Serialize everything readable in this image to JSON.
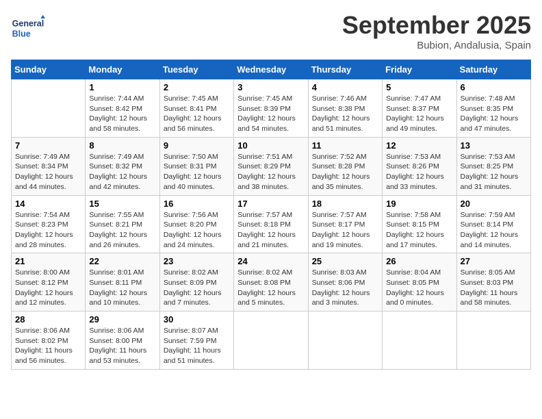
{
  "logo": {
    "text_general": "General",
    "text_blue": "Blue"
  },
  "title": "September 2025",
  "subtitle": "Bubion, Andalusia, Spain",
  "days_header": [
    "Sunday",
    "Monday",
    "Tuesday",
    "Wednesday",
    "Thursday",
    "Friday",
    "Saturday"
  ],
  "weeks": [
    [
      {
        "num": "",
        "info": ""
      },
      {
        "num": "1",
        "info": "Sunrise: 7:44 AM\nSunset: 8:42 PM\nDaylight: 12 hours and 58 minutes."
      },
      {
        "num": "2",
        "info": "Sunrise: 7:45 AM\nSunset: 8:41 PM\nDaylight: 12 hours and 56 minutes."
      },
      {
        "num": "3",
        "info": "Sunrise: 7:45 AM\nSunset: 8:39 PM\nDaylight: 12 hours and 54 minutes."
      },
      {
        "num": "4",
        "info": "Sunrise: 7:46 AM\nSunset: 8:38 PM\nDaylight: 12 hours and 51 minutes."
      },
      {
        "num": "5",
        "info": "Sunrise: 7:47 AM\nSunset: 8:37 PM\nDaylight: 12 hours and 49 minutes."
      },
      {
        "num": "6",
        "info": "Sunrise: 7:48 AM\nSunset: 8:35 PM\nDaylight: 12 hours and 47 minutes."
      }
    ],
    [
      {
        "num": "7",
        "info": "Sunrise: 7:49 AM\nSunset: 8:34 PM\nDaylight: 12 hours and 44 minutes."
      },
      {
        "num": "8",
        "info": "Sunrise: 7:49 AM\nSunset: 8:32 PM\nDaylight: 12 hours and 42 minutes."
      },
      {
        "num": "9",
        "info": "Sunrise: 7:50 AM\nSunset: 8:31 PM\nDaylight: 12 hours and 40 minutes."
      },
      {
        "num": "10",
        "info": "Sunrise: 7:51 AM\nSunset: 8:29 PM\nDaylight: 12 hours and 38 minutes."
      },
      {
        "num": "11",
        "info": "Sunrise: 7:52 AM\nSunset: 8:28 PM\nDaylight: 12 hours and 35 minutes."
      },
      {
        "num": "12",
        "info": "Sunrise: 7:53 AM\nSunset: 8:26 PM\nDaylight: 12 hours and 33 minutes."
      },
      {
        "num": "13",
        "info": "Sunrise: 7:53 AM\nSunset: 8:25 PM\nDaylight: 12 hours and 31 minutes."
      }
    ],
    [
      {
        "num": "14",
        "info": "Sunrise: 7:54 AM\nSunset: 8:23 PM\nDaylight: 12 hours and 28 minutes."
      },
      {
        "num": "15",
        "info": "Sunrise: 7:55 AM\nSunset: 8:21 PM\nDaylight: 12 hours and 26 minutes."
      },
      {
        "num": "16",
        "info": "Sunrise: 7:56 AM\nSunset: 8:20 PM\nDaylight: 12 hours and 24 minutes."
      },
      {
        "num": "17",
        "info": "Sunrise: 7:57 AM\nSunset: 8:18 PM\nDaylight: 12 hours and 21 minutes."
      },
      {
        "num": "18",
        "info": "Sunrise: 7:57 AM\nSunset: 8:17 PM\nDaylight: 12 hours and 19 minutes."
      },
      {
        "num": "19",
        "info": "Sunrise: 7:58 AM\nSunset: 8:15 PM\nDaylight: 12 hours and 17 minutes."
      },
      {
        "num": "20",
        "info": "Sunrise: 7:59 AM\nSunset: 8:14 PM\nDaylight: 12 hours and 14 minutes."
      }
    ],
    [
      {
        "num": "21",
        "info": "Sunrise: 8:00 AM\nSunset: 8:12 PM\nDaylight: 12 hours and 12 minutes."
      },
      {
        "num": "22",
        "info": "Sunrise: 8:01 AM\nSunset: 8:11 PM\nDaylight: 12 hours and 10 minutes."
      },
      {
        "num": "23",
        "info": "Sunrise: 8:02 AM\nSunset: 8:09 PM\nDaylight: 12 hours and 7 minutes."
      },
      {
        "num": "24",
        "info": "Sunrise: 8:02 AM\nSunset: 8:08 PM\nDaylight: 12 hours and 5 minutes."
      },
      {
        "num": "25",
        "info": "Sunrise: 8:03 AM\nSunset: 8:06 PM\nDaylight: 12 hours and 3 minutes."
      },
      {
        "num": "26",
        "info": "Sunrise: 8:04 AM\nSunset: 8:05 PM\nDaylight: 12 hours and 0 minutes."
      },
      {
        "num": "27",
        "info": "Sunrise: 8:05 AM\nSunset: 8:03 PM\nDaylight: 11 hours and 58 minutes."
      }
    ],
    [
      {
        "num": "28",
        "info": "Sunrise: 8:06 AM\nSunset: 8:02 PM\nDaylight: 11 hours and 56 minutes."
      },
      {
        "num": "29",
        "info": "Sunrise: 8:06 AM\nSunset: 8:00 PM\nDaylight: 11 hours and 53 minutes."
      },
      {
        "num": "30",
        "info": "Sunrise: 8:07 AM\nSunset: 7:59 PM\nDaylight: 11 hours and 51 minutes."
      },
      {
        "num": "",
        "info": ""
      },
      {
        "num": "",
        "info": ""
      },
      {
        "num": "",
        "info": ""
      },
      {
        "num": "",
        "info": ""
      }
    ]
  ]
}
